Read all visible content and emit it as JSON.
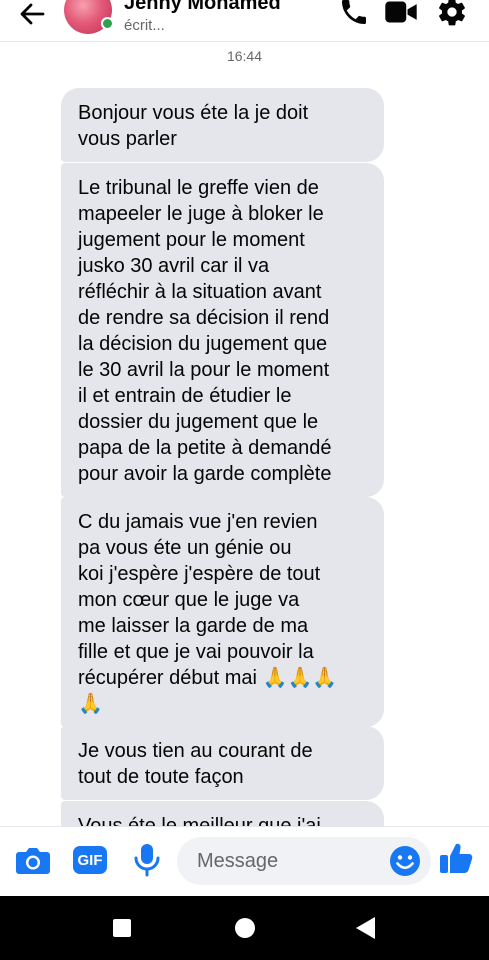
{
  "header": {
    "contact_name": "Jenny Mohamed",
    "status": "écrit..."
  },
  "chat": {
    "timestamp": "16:44",
    "messages": [
      {
        "text": "Bonjour vous éte la je doit\nvous parler"
      },
      {
        "text": "Le tribunal le greffe vien de\nmapeeler le juge à bloker le\njugement pour le moment\njusko 30 avril car il va\nréfléchir à la situation avant\nde rendre sa décision il rend\nla décision du jugement que\nle 30 avril la pour le moment\nil et entrain de étudier le\ndossier du jugement que le\npapa de la petite à demandé\npour avoir la garde complète"
      },
      {
        "text": "C du jamais vue j'en revien\npa vous éte un génie ou\nkoi j'espère j'espère de tout\nmon cœur que le juge va\nme laisser la garde de ma\nfille et que je vai pouvoir la\nrécupérer début mai 🙏🙏🙏\n🙏"
      },
      {
        "text": "Je vous tien au courant de\ntout de toute façon"
      },
      {
        "text": "Vous éte le meilleur que j'ai"
      }
    ]
  },
  "composer": {
    "gif_label": "GIF",
    "placeholder": "Message"
  },
  "icons": {
    "back": "arrow-left-icon",
    "call": "phone-icon",
    "video": "video-camera-icon",
    "settings": "gear-icon",
    "camera": "camera-icon",
    "mic": "microphone-icon",
    "emoji": "smiley-icon",
    "like": "thumbs-up-icon"
  },
  "colors": {
    "accent": "#1877f2",
    "bubble": "#e4e6eb",
    "online": "#31a24c"
  }
}
